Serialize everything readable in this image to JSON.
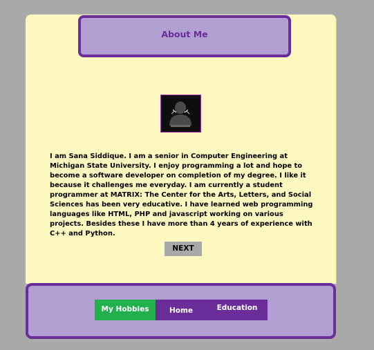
{
  "header": {
    "title": "About Me"
  },
  "profile": {
    "avatar_icon": "person-silhouette-icon",
    "bio": "I am Sana Siddique. I am a senior in Computer Engineering at Michigan State University. I enjoy programming a lot and hope to become a software developer on completion of my degree. I like it because it challenges me everyday. I am currently a student programmer at MATRIX: The Center for the Arts, Letters, and Social Sciences has been very educative. I have learned web programming languages like HTML, PHP and javascript working on various projects. Besides these I have more than 4 years of experience with C++ and Python."
  },
  "actions": {
    "next_label": "NEXT"
  },
  "nav": {
    "items": [
      {
        "label": "My Hobbies",
        "active": true
      },
      {
        "label": "Home",
        "active": false
      },
      {
        "label": "Education",
        "active": false
      }
    ]
  },
  "colors": {
    "page_background": "#a9a9a9",
    "card_background": "#fdf8bf",
    "panel_fill": "#b19fd1",
    "accent_purple": "#6b2d99",
    "active_tab": "#21b04c",
    "button_gray": "#a8a8a8"
  }
}
